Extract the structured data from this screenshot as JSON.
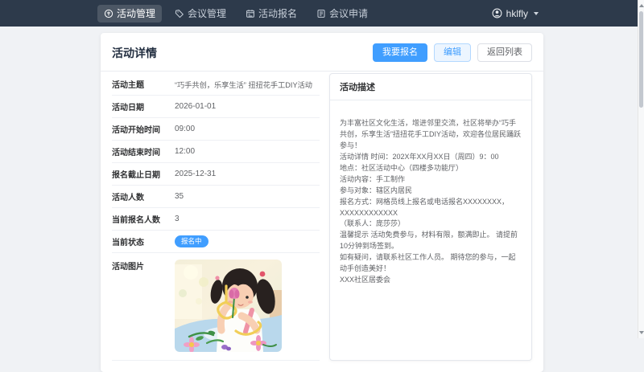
{
  "navbar": {
    "items": [
      {
        "label": "活动管理",
        "icon": "activity-management-icon",
        "active": true
      },
      {
        "label": "会议管理",
        "icon": "meeting-management-icon",
        "active": false
      },
      {
        "label": "活动报名",
        "icon": "activity-signup-icon",
        "active": false
      },
      {
        "label": "会议申请",
        "icon": "meeting-apply-icon",
        "active": false
      }
    ],
    "user": {
      "name": "hklfly",
      "icon": "avatar-icon",
      "caret_icon": "chevron-down-icon"
    }
  },
  "page": {
    "title": "活动详情",
    "actions": {
      "signup": "我要报名",
      "edit": "编辑",
      "back": "返回列表"
    }
  },
  "details": {
    "rows": [
      {
        "label": "活动主题",
        "value": "“巧手共创，乐享生活” 扭扭花手工DIY活动"
      },
      {
        "label": "活动日期",
        "value": "2026-01-01"
      },
      {
        "label": "活动开始时间",
        "value": "09:00"
      },
      {
        "label": "活动结束时间",
        "value": "12:00"
      },
      {
        "label": "报名截止日期",
        "value": "2025-12-31"
      },
      {
        "label": "活动人数",
        "value": "35"
      },
      {
        "label": "当前报名人数",
        "value": "3"
      },
      {
        "label": "当前状态",
        "value": "报名中"
      },
      {
        "label": "活动图片",
        "value": ""
      }
    ],
    "image_alt": "girl-making-pipe-cleaner-flowers-illustration"
  },
  "description": {
    "title": "活动描述",
    "body": "为丰富社区文化生活，增进邻里交流，社区将举办“巧手共创，乐享生活”扭扭花手工DIY活动，欢迎各位居民踊跃参与！\n活动详情 时间：202X年XX月XX日（周四）9：00\n地点：社区活动中心（四楼多功能厅）\n活动内容：手工制作\n参与对象：辖区内居民\n报名方式：网格员线上报名或电话报名XXXXXXXX，XXXXXXXXXXXX\n（联系人：庞莎莎）\n温馨提示 活动免费参与，材料有限，额满即止。 请提前10分钟到场签到。\n如有疑问，请联系社区工作人员。 期待您的参与，一起动手创造美好！\nXXX社区居委会"
  },
  "colors": {
    "navbar_bg": "#2d3a4b",
    "primary": "#409eff",
    "badge_bg": "#409eff",
    "page_bg": "#f0f2f5",
    "card_bg": "#ffffff"
  }
}
